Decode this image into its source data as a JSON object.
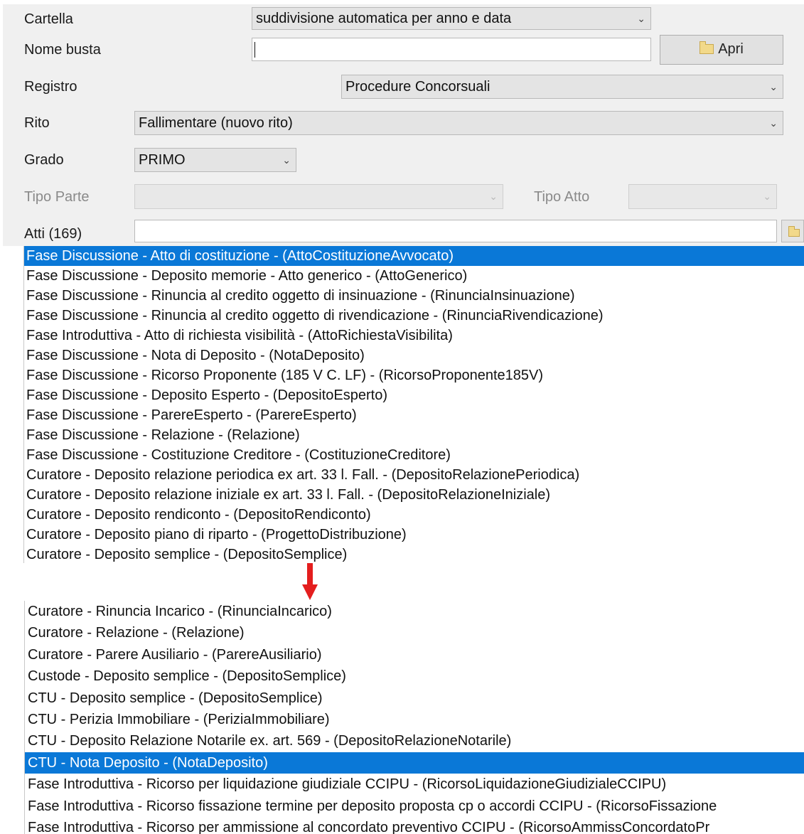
{
  "form": {
    "cartella": {
      "label": "Cartella",
      "value": "suddivisione automatica per anno e data"
    },
    "nome_busta": {
      "label": "Nome busta",
      "value": ""
    },
    "apri_button": {
      "label": "Apri"
    },
    "registro": {
      "label": "Registro",
      "value": "Procedure Concorsuali"
    },
    "rito": {
      "label": "Rito",
      "value": "Fallimentare (nuovo rito)"
    },
    "grado": {
      "label": "Grado",
      "value": "PRIMO"
    },
    "tipo_parte": {
      "label": "Tipo Parte",
      "value": ""
    },
    "tipo_atto": {
      "label": "Tipo Atto",
      "value": ""
    },
    "atti": {
      "label": "Atti (169)",
      "value": ""
    }
  },
  "list_top": {
    "selected_index": 0,
    "items": [
      "Fase Discussione - Atto di costituzione - (AttoCostituzioneAvvocato)",
      "Fase Discussione - Deposito memorie - Atto generico - (AttoGenerico)",
      "Fase Discussione - Rinuncia al credito oggetto di insinuazione - (RinunciaInsinuazione)",
      "Fase Discussione - Rinuncia al credito oggetto di rivendicazione - (RinunciaRivendicazione)",
      "Fase Introduttiva - Atto di richiesta visibilità - (AttoRichiestaVisibilita)",
      "Fase Discussione - Nota di Deposito - (NotaDeposito)",
      "Fase Discussione - Ricorso Proponente (185 V C. LF) - (RicorsoProponente185V)",
      "Fase Discussione - Deposito Esperto - (DepositoEsperto)",
      "Fase Discussione - ParereEsperto - (ParereEsperto)",
      "Fase Discussione - Relazione - (Relazione)",
      "Fase Discussione - Costituzione Creditore - (CostituzioneCreditore)",
      "Curatore - Deposito relazione periodica ex art. 33 l. Fall. - (DepositoRelazionePeriodica)",
      "Curatore - Deposito relazione iniziale ex art. 33 l. Fall. - (DepositoRelazioneIniziale)",
      "Curatore - Deposito rendiconto - (DepositoRendiconto)",
      "Curatore - Deposito piano di riparto - (ProgettoDistribuzione)",
      "Curatore - Deposito semplice - (DepositoSemplice)"
    ]
  },
  "list_bottom": {
    "selected_index": 7,
    "items": [
      "Curatore - Rinuncia Incarico - (RinunciaIncarico)",
      "Curatore - Relazione - (Relazione)",
      "Curatore - Parere Ausiliario - (ParereAusiliario)",
      "Custode - Deposito semplice - (DepositoSemplice)",
      "CTU - Deposito semplice - (DepositoSemplice)",
      "CTU - Perizia Immobiliare - (PeriziaImmobiliare)",
      "CTU - Deposito Relazione Notarile ex. art. 569 - (DepositoRelazioneNotarile)",
      "CTU - Nota Deposito - (NotaDeposito)",
      "Fase Introduttiva - Ricorso per liquidazione giudiziale CCIPU - (RicorsoLiquidazioneGiudizialeCCIPU)",
      "Fase Introduttiva - Ricorso fissazione termine per deposito proposta cp o accordi CCIPU - (RicorsoFissazione",
      "Fase Introduttiva - Ricorso per ammissione al concordato preventivo CCIPU - (RicorsoAmmissConcordatoPr"
    ]
  },
  "colors": {
    "selection": "#0a78d7",
    "arrow": "#e41e1e"
  },
  "icons": {
    "apri": "folder-search-icon",
    "atti_search": "folder-search-icon",
    "dropdown": "chevron-down-icon"
  }
}
